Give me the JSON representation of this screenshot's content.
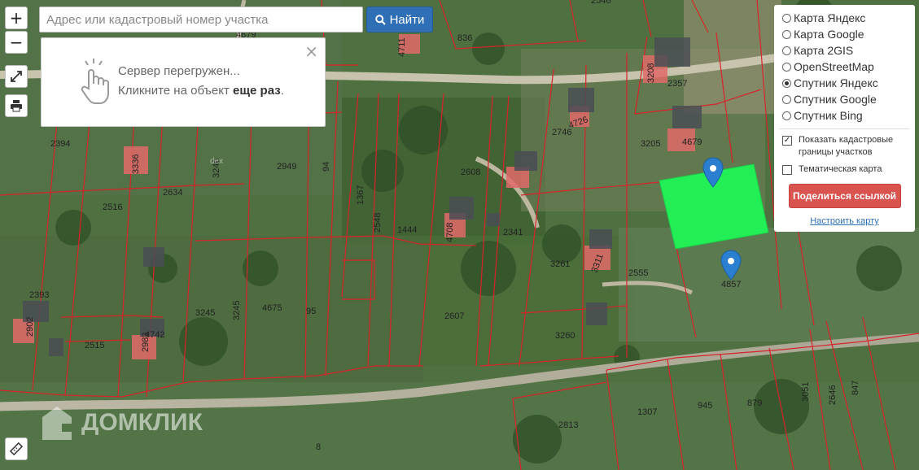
{
  "search": {
    "placeholder": "Адрес или кадастровый номер участка",
    "button_label": "Найти"
  },
  "zoom": {
    "in_label": "+",
    "out_label": "−"
  },
  "popup": {
    "line1": "Сервер перегружен...",
    "line2_prefix": "Кликните на объект ",
    "line2_bold": "еще раз",
    "line2_suffix": "."
  },
  "layers": {
    "options": [
      {
        "label": "Карта Яндекс",
        "selected": false
      },
      {
        "label": "Карта Google",
        "selected": false
      },
      {
        "label": "Карта 2GIS",
        "selected": false
      },
      {
        "label": "OpenStreetMap",
        "selected": false
      },
      {
        "label": "Спутник Яндекс",
        "selected": true
      },
      {
        "label": "Спутник Google",
        "selected": false
      },
      {
        "label": "Спутник Bing",
        "selected": false
      }
    ],
    "show_boundaries_label": "Показать кадастровые границы участков",
    "show_boundaries_checked": true,
    "thematic_label": "Тематическая карта",
    "thematic_checked": false,
    "share_label": "Поделиться ссылкой",
    "configure_label": "Настроить карту"
  },
  "watermark": {
    "text": "ДОМКЛИК"
  },
  "provider_mark": "dex",
  "highlight_color": "#22ee55",
  "boundary_color": "#d8232a",
  "marker_color": "#2a7fd0",
  "plots": [
    "4679",
    "836",
    "2546",
    "2357",
    "3208",
    "4726",
    "2746",
    "4679",
    "3205",
    "2394",
    "3336",
    "2634",
    "2516",
    "3246",
    "2949",
    "94",
    "1367",
    "2548",
    "1444",
    "2608",
    "4708",
    "2341",
    "3261",
    "3311",
    "2555",
    "4857",
    "2393",
    "2902",
    "2515",
    "4742",
    "2983",
    "3245",
    "3245",
    "4675",
    "95",
    "2607",
    "3260",
    "1307",
    "945",
    "879",
    "3051",
    "2646",
    "847",
    "2813",
    "8",
    "4711"
  ]
}
